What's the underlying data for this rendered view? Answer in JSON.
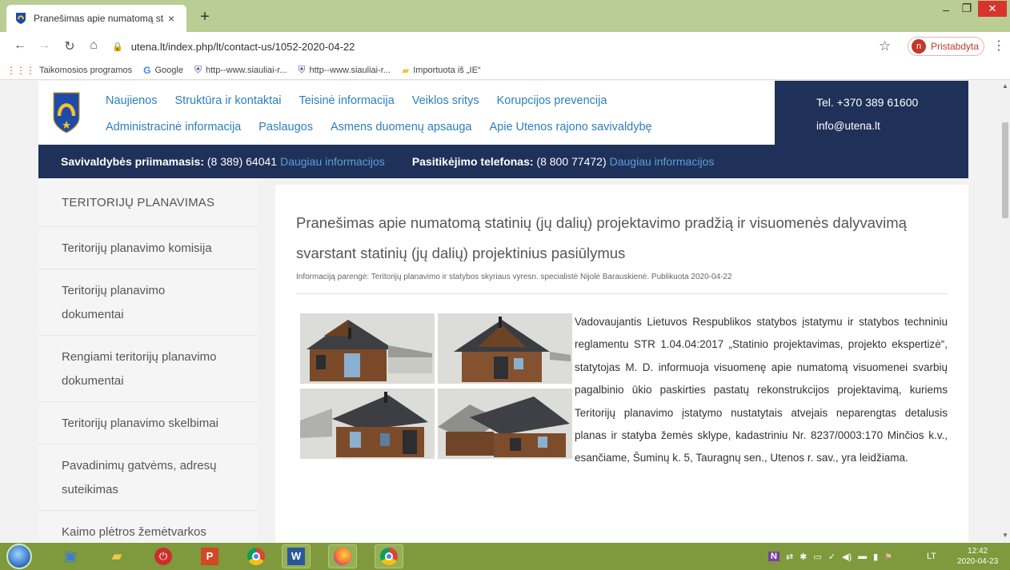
{
  "browser": {
    "tab_title": "Pranešimas apie numatomą stati",
    "tab_close": "×",
    "new_tab": "+",
    "address": "utena.lt/index.php/lt/contact-us/1052-2020-04-22",
    "profile_initial": "n",
    "profile_label": "Pristabdyta",
    "window_min": "–",
    "window_max": "❐",
    "window_close": "✕",
    "bookmarks": [
      {
        "icon": "apps-grid-icon",
        "label": "Taikomosios programos"
      },
      {
        "icon": "google-icon",
        "label": "Google"
      },
      {
        "icon": "siauliai-crest-icon",
        "label": "http--www.siauliai-r..."
      },
      {
        "icon": "siauliai-crest-icon",
        "label": "http--www.siauliai-r..."
      },
      {
        "icon": "folder-icon",
        "label": "Importuota iš „IE“"
      }
    ]
  },
  "site": {
    "nav_row1": [
      "Naujienos",
      "Struktūra ir kontaktai",
      "Teisinė informacija",
      "Veiklos sritys",
      "Korupcijos prevencija"
    ],
    "nav_row2": [
      "Administracinė informacija",
      "Paslaugos",
      "Asmens duomenų apsauga",
      "Apie Utenos rajono savivaldybę"
    ],
    "phone": "Tel. +370 389 61600",
    "email": "info@utena.lt",
    "info_bar": {
      "reception_label": "Savivaldybės priimamasis:",
      "reception_phone": "(8 389) 64041",
      "more1": "Daugiau informacijos",
      "trust_label": "Pasitikėjimo telefonas:",
      "trust_phone": "(8 800 77472)",
      "more2": "Daugiau informacijos"
    }
  },
  "sidebar": {
    "heading": "TERITORIJŲ PLANAVIMAS",
    "items": [
      "Teritorijų planavimo komisija",
      "Teritorijų planavimo dokumentai",
      "Rengiami teritorijų planavimo dokumentai",
      "Teritorijų planavimo skelbimai",
      "Pavadinimų gatvėms, adresų suteikimas",
      "Kaimo plėtros žemėtvarkos projektai"
    ]
  },
  "article": {
    "title": "Pranešimas apie numatomą statinių (jų dalių) projektavimo pradžią ir visuomenės dalyvavimą svarstant statinių (jų dalių) projektinius pasiūlymus",
    "byline": "Informaciją parengė: Teritorijų planavimo ir statybos skyriaus vyresn. specialistė Nijolė Barauskienė. Publikuota 2020-04-22",
    "body": "Vadovaujantis Lietuvos Respublikos statybos įstatymu ir statybos techniniu reglamentu STR 1.04.04:2017 „Statinio projektavimas, projekto ekspertizė“, statytojas M. D. informuoja visuomenę apie numatomą visuomenei svarbių pagalbinio ūkio paskirties pastatų rekonstrukcijos projektavimą, kuriems Teritorijų planavimo įstatymo nustatytais atvejais neparengtas detalusis planas ir statyba žemės sklype, kadastriniu Nr. 8237/0003:170 Minčios k.v., esančiame, Šuminų k. 5, Tauragnų sen., Utenos r. sav., yra leidžiama."
  },
  "taskbar": {
    "apps": [
      "start-orb-icon",
      "file-manager-icon",
      "explorer-folder-icon",
      "power-icon",
      "powerpoint-icon",
      "chrome-icon",
      "word-icon",
      "firefox-icon",
      "chrome-active-icon"
    ],
    "lang": "LT",
    "time": "12:42",
    "date": "2020-04-23"
  },
  "colors": {
    "nav_blue": "#2c7fbd",
    "header_navy": "#1f3158",
    "link_light_blue": "#5aa0dc",
    "titlebar_green": "#b9cd94",
    "taskbar_green": "#7e9a3c"
  }
}
